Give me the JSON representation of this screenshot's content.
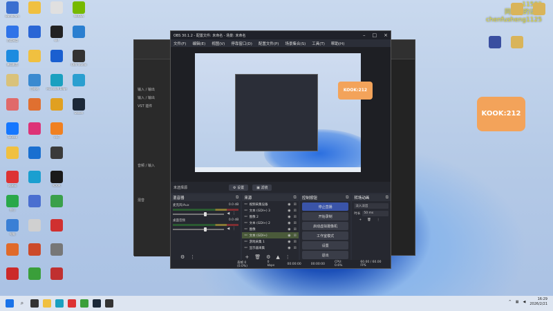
{
  "watermark": {
    "line1": "11582",
    "line2": "同频的的话群",
    "line3": "chenfusheng1125"
  },
  "desktop_icons": [
    {
      "label": "Bandicam",
      "color": "#3a6fd0"
    },
    {
      "label": "百度网盘",
      "color": "#2f73e8"
    },
    {
      "label": "暴风影音",
      "color": "#1c8be0"
    },
    {
      "label": "",
      "color": "#d9c27a"
    },
    {
      "label": "",
      "color": "#e06a6a"
    },
    {
      "label": "ToDesk",
      "color": "#1577ff"
    },
    {
      "label": "",
      "color": "#f0c040"
    },
    {
      "label": "网易云",
      "color": "#d33"
    },
    {
      "label": "金山",
      "color": "#2aa84a"
    },
    {
      "label": "电脑",
      "color": "#3a7fd5"
    },
    {
      "label": "",
      "color": "#e06a2a"
    },
    {
      "label": "",
      "color": "#cc2a2a"
    },
    {
      "label": "",
      "color": "#f0c040"
    },
    {
      "label": "",
      "color": "#2a66d5"
    },
    {
      "label": "",
      "color": "#f0c040"
    },
    {
      "label": "回收站",
      "color": "#3a8ad0"
    },
    {
      "label": "",
      "color": "#e07030"
    },
    {
      "label": "",
      "color": "#dd3377"
    },
    {
      "label": "",
      "color": "#1a6fd0"
    },
    {
      "label": "",
      "color": "#1a9fd0"
    },
    {
      "label": "",
      "color": "#4a6fd0"
    },
    {
      "label": "",
      "color": "#d0d0d0"
    },
    {
      "label": "",
      "color": "#cc4a2a"
    },
    {
      "label": "",
      "color": "#3a9f3a"
    },
    {
      "label": "",
      "color": "#e0e0e0"
    },
    {
      "label": "kk!",
      "color": "#222"
    },
    {
      "label": "",
      "color": "#1a5fd0"
    },
    {
      "label": "Microsoft Edge",
      "color": "#1aa0c0"
    },
    {
      "label": "",
      "color": "#e0a020"
    },
    {
      "label": "VLC",
      "color": "#f08020"
    },
    {
      "label": "",
      "color": "#3a3a3a"
    },
    {
      "label": "KOOK",
      "color": "#1a1a1a"
    },
    {
      "label": "",
      "color": "#3aa04a"
    },
    {
      "label": "",
      "color": "#d03030"
    },
    {
      "label": "",
      "color": "#777"
    },
    {
      "label": "",
      "color": "#c03030"
    },
    {
      "label": "NVIDIA",
      "color": "#76b900"
    },
    {
      "label": "",
      "color": "#2a7fd0"
    },
    {
      "label": "OBS Studio",
      "color": "#333"
    },
    {
      "label": "",
      "color": "#2a9fd0"
    },
    {
      "label": "Steam",
      "color": "#1b2838"
    }
  ],
  "daw": {
    "meta1": "输入 / 输出",
    "meta2": "输入 / 输出",
    "meta3": "VST 插件",
    "meta4": "音频 / 输入",
    "meta5": "混音"
  },
  "obs": {
    "title": "OBS 30.1.2 - 配置文件: 未命名 - 场景: 未命名",
    "menu": [
      "文件(F)",
      "编辑(E)",
      "视图(V)",
      "停靠窗口(D)",
      "配置文件(P)",
      "场景集合(S)",
      "工具(T)",
      "帮助(H)"
    ],
    "no_source": "未选择源",
    "settings_btn": "⚙ 设置",
    "filters_btn": "▣ 滤镜",
    "preview_badge": "KOOK:212",
    "mixer": {
      "title": "混音器",
      "tracks": [
        {
          "name": "麦克风/Aux",
          "level": "0.0 dB"
        },
        {
          "name": "桌面音频",
          "level": "0.0 dB"
        }
      ]
    },
    "sources": {
      "title": "来源",
      "items": [
        {
          "name": "视频采集设备",
          "selected": false
        },
        {
          "name": "文本 (GDI+) 3",
          "selected": false
        },
        {
          "name": "图像 2",
          "selected": false
        },
        {
          "name": "文本 (GDI+) 2",
          "selected": false
        },
        {
          "name": "图像",
          "selected": false
        },
        {
          "name": "文本 (GDI+)",
          "selected": true
        },
        {
          "name": "游戏采集 1",
          "selected": false
        },
        {
          "name": "显示器采集",
          "selected": false
        }
      ]
    },
    "controls": {
      "title": "控制按钮",
      "buttons": [
        "停止直播",
        "开始录制",
        "启动虚拟摄像机",
        "工作室模式",
        "设置",
        "退出"
      ]
    },
    "transitions": {
      "title": "转场动画",
      "type": "淡入淡出",
      "duration_label": "时长",
      "duration": "50 ms"
    },
    "tabs": [
      "混音器",
      "场景"
    ],
    "status": {
      "dropped": "丢帧 0 (0.0%)",
      "kbps": "0 kbps",
      "rec_time": "00:00:00",
      "stream_time": "00:00:00",
      "cpu": "CPU: 0.6%",
      "fps": "60.00 / 60.00 FPS"
    }
  },
  "taskbar": {
    "time": "16:29",
    "date": "2026/2/21"
  }
}
